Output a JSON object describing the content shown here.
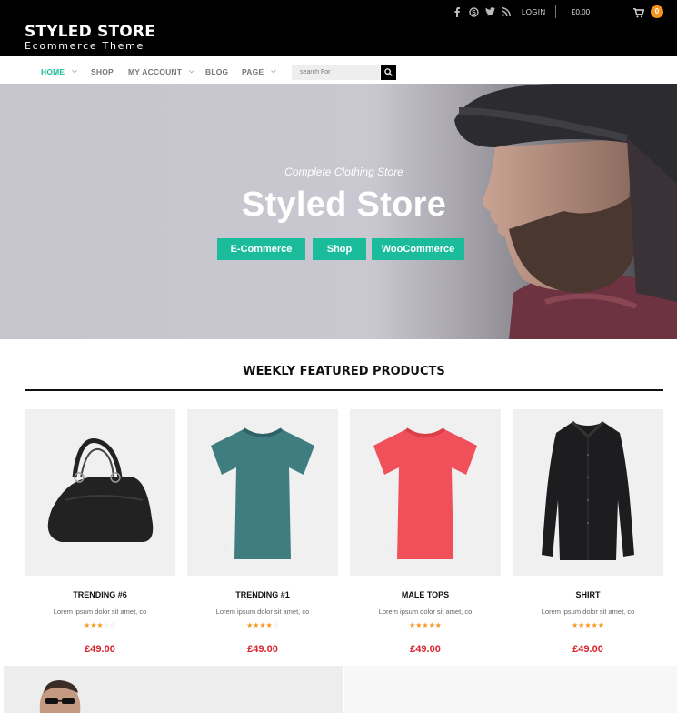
{
  "header": {
    "title": "STYLED STORE",
    "subtitle": "Ecommerce Theme",
    "social_icons": [
      "facebook-icon",
      "skype-icon",
      "twitter-icon",
      "rss-icon"
    ],
    "login_label": "LOGIN",
    "cart_total": "£0.00",
    "cart_count": "0"
  },
  "nav": {
    "items": [
      {
        "label": "HOME",
        "active": true,
        "has_dropdown": true
      },
      {
        "label": "SHOP",
        "active": false,
        "has_dropdown": false
      },
      {
        "label": "MY ACCOUNT",
        "active": false,
        "has_dropdown": true
      },
      {
        "label": "BLOG",
        "active": false,
        "has_dropdown": false
      },
      {
        "label": "PAGE",
        "active": false,
        "has_dropdown": true
      }
    ],
    "search_placeholder": "search For"
  },
  "hero": {
    "subtitle": "Complete Clothing Store",
    "title": "Styled Store",
    "buttons": [
      "E-Commerce",
      "Shop",
      "WooCommerce"
    ]
  },
  "featured": {
    "title": "WEEKLY FEATURED PRODUCTS",
    "products": [
      {
        "name": "TRENDING #6",
        "desc": "Lorem ipsum dolor sit amet, co",
        "rating": 3,
        "price": "£49.00",
        "icon": "handbag-icon"
      },
      {
        "name": "TRENDING #1",
        "desc": "Lorem ipsum dolor sit amet, co",
        "rating": 4,
        "price": "£49.00",
        "icon": "teal-tshirt-icon"
      },
      {
        "name": "MALE TOPS",
        "desc": "Lorem ipsum dolor sit amet, co",
        "rating": 5,
        "price": "£49.00",
        "icon": "red-tshirt-icon"
      },
      {
        "name": "SHIRT",
        "desc": "Lorem ipsum dolor sit amet, co",
        "rating": 5,
        "price": "£49.00",
        "icon": "black-shirt-icon"
      }
    ]
  },
  "colors": {
    "accent": "#1abc9c",
    "header_bg": "#000000",
    "badge": "#f7941d",
    "price": "#d9232d"
  }
}
